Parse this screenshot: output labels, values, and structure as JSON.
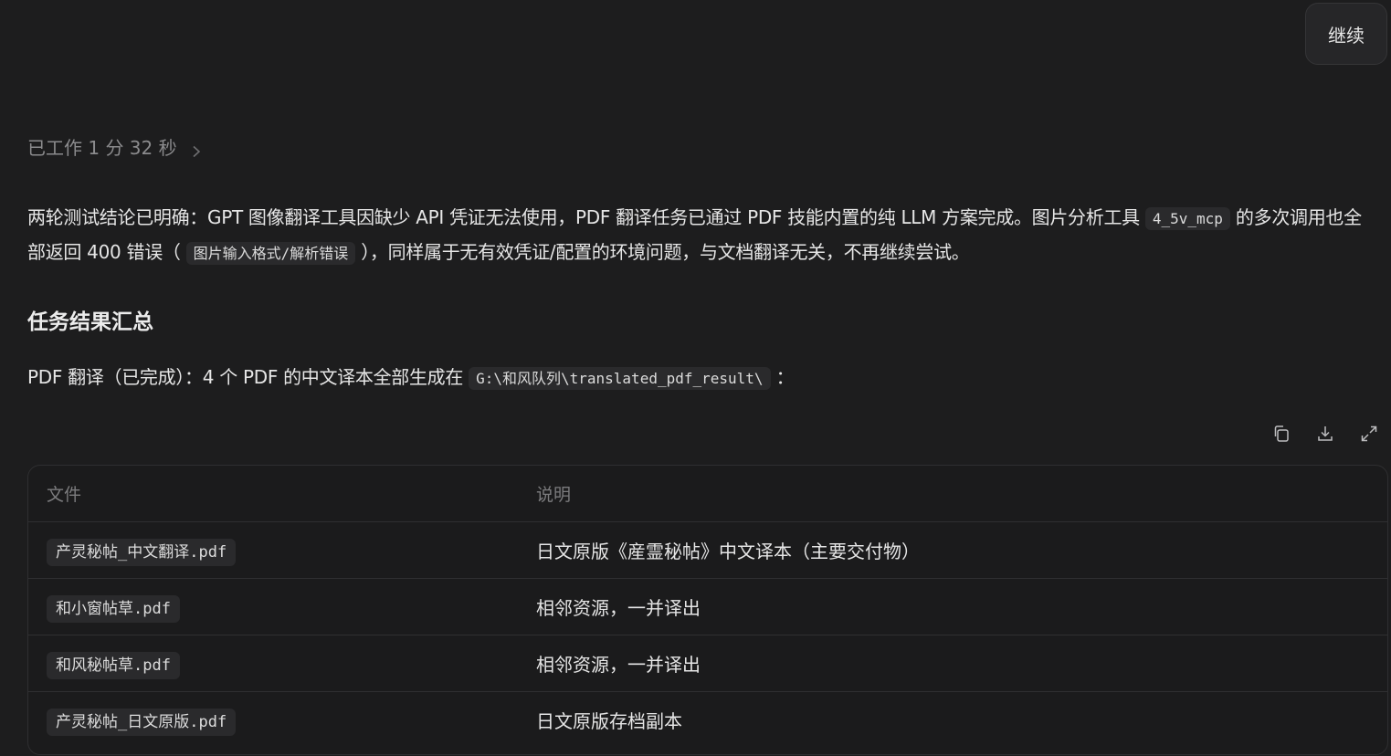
{
  "actions": {
    "continue_label": "继续"
  },
  "status": {
    "worked_label": "已工作 1 分 32 秒"
  },
  "summary": {
    "part1": "两轮测试结论已明确：GPT 图像翻译工具因缺少 API 凭证无法使用，PDF 翻译任务已通过 PDF 技能内置的纯 LLM 方案完成。图片分析工具",
    "code1": "4_5v_mcp",
    "part2": "的多次调用也全部返回 400 错误（",
    "code2": "图片输入格式/解析错误",
    "part3": "），同样属于无有效凭证/配置的环境问题，与文档翻译无关，不再继续尝试。"
  },
  "section": {
    "heading": "任务结果汇总",
    "pdf_line_before": "PDF 翻译（已完成）：4 个 PDF 的中文译本全部生成在",
    "pdf_path": "G:\\和风队列\\translated_pdf_result\\",
    "pdf_line_after": "："
  },
  "table_tools": {
    "icons": [
      "copy-icon",
      "download-icon",
      "expand-icon"
    ]
  },
  "table": {
    "headers": [
      "文件",
      "说明"
    ],
    "rows": [
      {
        "file": "产灵秘帖_中文翻译.pdf",
        "desc": "日文原版《産霊秘帖》中文译本（主要交付物）"
      },
      {
        "file": "和小窗帖草.pdf",
        "desc": "相邻资源，一并译出"
      },
      {
        "file": "和风秘帖草.pdf",
        "desc": "相邻资源，一并译出"
      },
      {
        "file": "产灵秘帖_日文原版.pdf",
        "desc": "日文原版存档副本"
      }
    ]
  },
  "colors": {
    "background": "#1d1d1e",
    "text": "#e6e6e6",
    "muted": "#8b8b8d",
    "code_bg": "#2a2a2c",
    "border": "#2f2f31"
  }
}
